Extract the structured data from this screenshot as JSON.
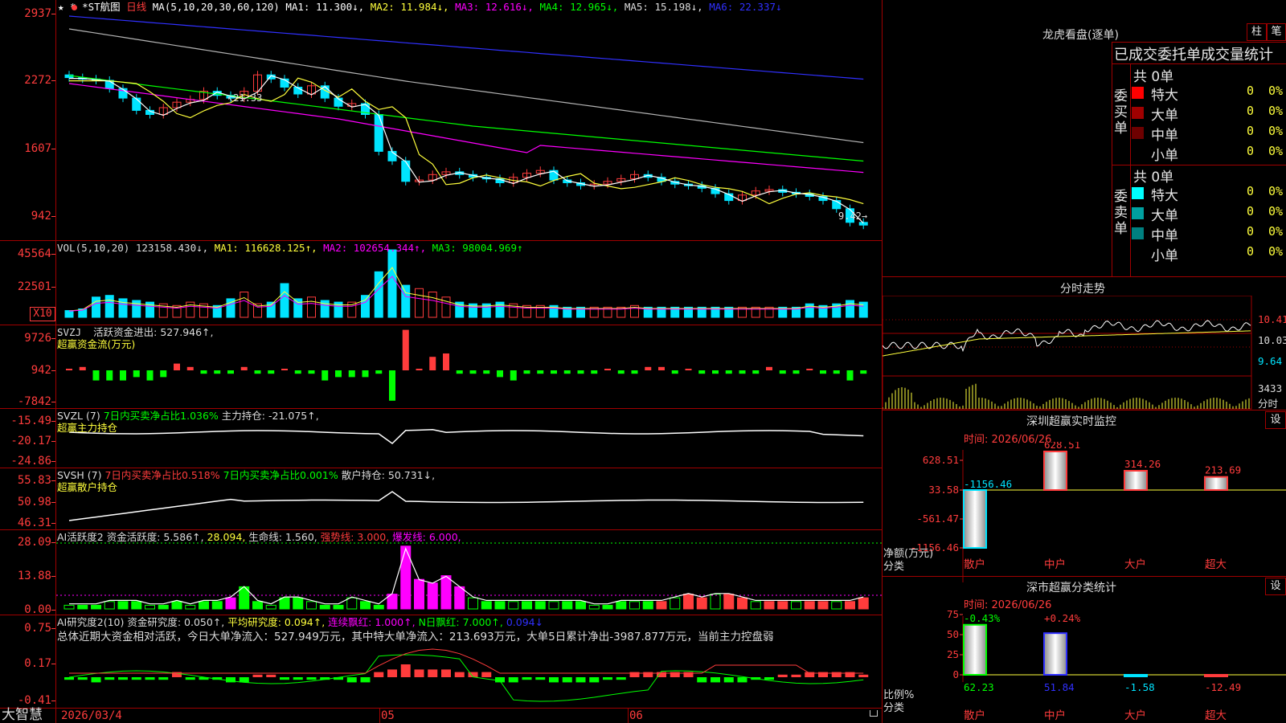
{
  "colors": {
    "bg": "#000000",
    "grid": "#a00000",
    "up": "#ff3c3c",
    "down": "#00e4ff",
    "text": "#c8c8c8",
    "yellow": "#ffff3c",
    "magenta": "#ff00ff",
    "green": "#00ff00",
    "blue": "#3030ff",
    "white": "#ffffff"
  },
  "main": {
    "header": {
      "stars": "★ *",
      "code": "*ST航图",
      "period": "日线",
      "ma": "MA(5,10,20,30,60,120)",
      "ma1": "MA1: 11.300↓,",
      "ma2": "MA2: 11.984↓,",
      "ma3": "MA3: 12.616↓,",
      "ma4": "MA4: 12.965↓,",
      "ma5": "MA5: 15.198↓,",
      "ma6": "MA6: 22.337↓"
    },
    "yaxis": [
      "2937",
      "2272",
      "1607",
      "942"
    ],
    "high_label": "21.33",
    "low_label": "9.42→",
    "icon": "info-dot-icon"
  },
  "vol": {
    "name": "VOL(5,10,20)",
    "value": "123158.430↓,",
    "ma1": "MA1: 116628.125↑,",
    "ma2": "MA2: 102654.344↑,",
    "ma3": "MA3: 98004.969↑",
    "yaxis": [
      "45564",
      "22501"
    ],
    "unit": "X10"
  },
  "svzj": {
    "name": "SVZJ",
    "label": "活跃资金进出: 527.946↑,",
    "sub": "超赢资金流(万元)",
    "yaxis": [
      "9726",
      "942",
      "-7842"
    ]
  },
  "svzl": {
    "name": "SVZL (7)",
    "a": "7日内买卖净占比1.036%",
    "b": "主力持仓: -21.075↑,",
    "sub": "超赢主力持仓",
    "yaxis": [
      "-15.49",
      "-20.17",
      "-24.86"
    ]
  },
  "svsh": {
    "name": "SVSH (7)",
    "a": "7日内买卖净占比0.518%",
    "b": "7日内买卖净占比0.001%",
    "c": "散户持仓: 50.731↓,",
    "sub": "超赢散户持仓",
    "yaxis": [
      "55.83",
      "50.98",
      "46.31"
    ]
  },
  "ai1": {
    "name": "AI活跃度2",
    "a": "资金活跃度: 5.586↑,",
    "b": "28.094,",
    "c": "生命线: 1.560,",
    "d": "强势线: 3.000,",
    "e": "爆发线: 6.000,",
    "yaxis": [
      "28.09",
      "13.88",
      "0.00"
    ]
  },
  "ai2": {
    "name": "AI研究度2(10)",
    "a": "资金研究度: 0.050↑,",
    "b": "平均研究度: 0.094↑,",
    "c": "连续飘红: 1.000↑,",
    "d": "N日飘红: 7.000↑,",
    "e": "0.094↓",
    "summary": "总体近期大资金相对活跃，今日大单净流入：527.949万元，其中特大单净流入：213.693万元，大单5日累计净出-3987.877万元，当前主力控盘弱",
    "yaxis": [
      "0.75",
      "0.17",
      "-0.41"
    ]
  },
  "xaxis": {
    "brand": "大智慧",
    "date": "2026/03/4",
    "m5": "05",
    "m6": "06"
  },
  "side": {
    "longhu": {
      "title": "龙虎看盘(逐单)",
      "btn_zhu": "柱",
      "btn_bi": "笔",
      "tab": "已成交委托单成交量统计",
      "buy": {
        "side_label": "委买单",
        "total": "共 0单",
        "rows": [
          {
            "label": "特大",
            "v": "0",
            "p": "0%",
            "c": "#ff0000"
          },
          {
            "label": "大单",
            "v": "0",
            "p": "0%",
            "c": "#a00000"
          },
          {
            "label": "中单",
            "v": "0",
            "p": "0%",
            "c": "#6e0000"
          },
          {
            "label": "小单",
            "v": "0",
            "p": "0%",
            "c": "#000000"
          }
        ]
      },
      "sell": {
        "side_label": "委卖单",
        "total": "共 0单",
        "rows": [
          {
            "label": "特大",
            "v": "0",
            "p": "0%",
            "c": "#00ffff"
          },
          {
            "label": "大单",
            "v": "0",
            "p": "0%",
            "c": "#00a0a0"
          },
          {
            "label": "中单",
            "v": "0",
            "p": "0%",
            "c": "#008080"
          },
          {
            "label": "小单",
            "v": "0",
            "p": "0%",
            "c": "#000000"
          }
        ]
      }
    },
    "intraday": {
      "title": "分时走势",
      "y": [
        "10.41",
        "10.03",
        "9.64"
      ],
      "vol": "3433",
      "vol_label": "分时"
    },
    "monitor": {
      "title": "深圳超赢实时监控",
      "btn": "设",
      "time": "时间: 2026/06/26",
      "yaxis": [
        "628.51",
        "33.58",
        "-561.47",
        "-1156.46"
      ],
      "ylabel": "净额(万元)",
      "xlabel": "分类",
      "chart_data": {
        "type": "bar",
        "categories": [
          "散户",
          "中户",
          "大户",
          "超大"
        ],
        "values": [
          -1156.46,
          628.51,
          314.26,
          213.69
        ],
        "ylim": [
          -1156.46,
          628.51
        ],
        "labels": [
          "-1156.46",
          "628.51",
          "314.26",
          "213.69"
        ]
      }
    },
    "classify": {
      "title": "深市超赢分类统计",
      "btn": "设",
      "time": "时间: 2026/06/26",
      "yaxis": [
        "75",
        "50",
        "25",
        "0"
      ],
      "ylabel": "比例%",
      "xlabel": "分类",
      "chart_data": {
        "type": "bar",
        "categories": [
          "散户",
          "中户",
          "大户",
          "超大"
        ],
        "values": [
          62.23,
          51.84,
          -1.58,
          -12.49
        ],
        "ylim": [
          0,
          75
        ],
        "change": [
          "-0.43%",
          "+0.24%",
          "",
          ""
        ],
        "labels": [
          "62.23",
          "51.84",
          "-1.58",
          "-12.49"
        ]
      }
    }
  }
}
